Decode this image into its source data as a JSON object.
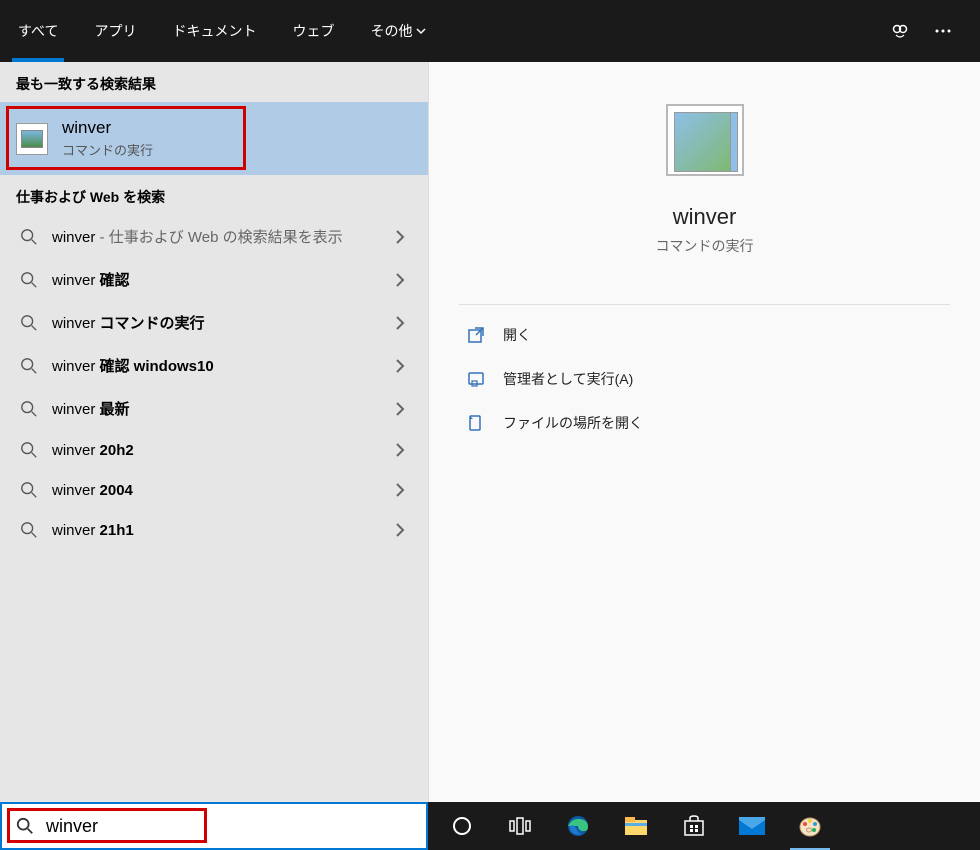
{
  "header": {
    "tabs": [
      "すべて",
      "アプリ",
      "ドキュメント",
      "ウェブ",
      "その他"
    ]
  },
  "left": {
    "bestMatchHeader": "最も一致する検索結果",
    "bestMatch": {
      "title": "winver",
      "subtitle": "コマンドの実行"
    },
    "webHeader": "仕事および Web を検索",
    "suggestions": [
      {
        "prefix": "winver",
        "suffix": " - 仕事および Web の検索結果を表示"
      },
      {
        "prefix": "winver ",
        "bold": "確認"
      },
      {
        "prefix": "winver ",
        "bold": "コマンドの実行"
      },
      {
        "prefix": "winver ",
        "bold": "確認 windows10"
      },
      {
        "prefix": "winver ",
        "bold": "最新"
      },
      {
        "prefix": "winver ",
        "bold": "20h2"
      },
      {
        "prefix": "winver ",
        "bold": "2004"
      },
      {
        "prefix": "winver ",
        "bold": "21h1"
      }
    ]
  },
  "right": {
    "title": "winver",
    "subtitle": "コマンドの実行",
    "actions": [
      "開く",
      "管理者として実行(A)",
      "ファイルの場所を開く"
    ]
  },
  "search": {
    "value": "winver"
  }
}
